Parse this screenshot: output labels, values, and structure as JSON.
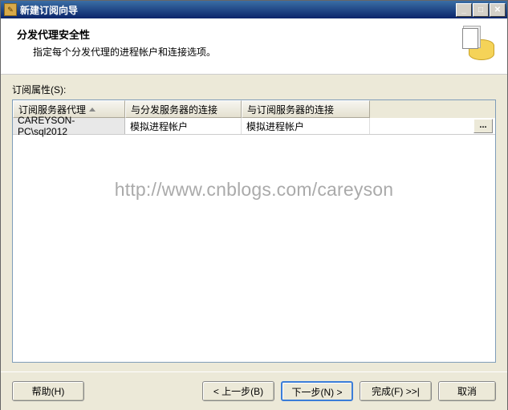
{
  "window": {
    "title": "新建订阅向导"
  },
  "header": {
    "title": "分发代理安全性",
    "subtitle": "指定每个分发代理的进程帐户和连接选项。"
  },
  "content": {
    "label": "订阅属性(S):"
  },
  "grid": {
    "columns": {
      "col1": "订阅服务器代理",
      "col2": "与分发服务器的连接",
      "col3": "与订阅服务器的连接"
    },
    "rows": [
      {
        "agent": "CAREYSON-PC\\sql2012",
        "dist_conn": "模拟进程帐户",
        "sub_conn": "模拟进程帐户"
      }
    ]
  },
  "watermark": "http://www.cnblogs.com/careyson",
  "buttons": {
    "help": "帮助(H)",
    "back": "< 上一步(B)",
    "next": "下一步(N) >",
    "finish": "完成(F) >>|",
    "cancel": "取消"
  }
}
